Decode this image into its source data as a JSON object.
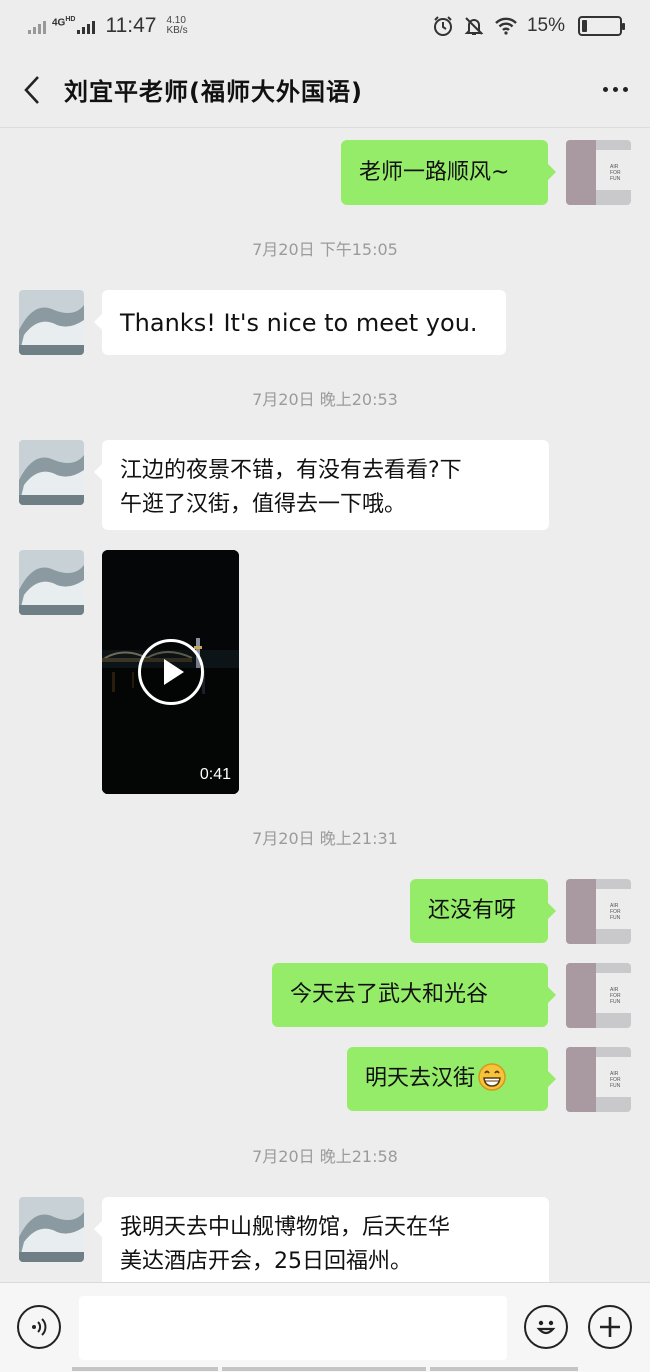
{
  "status_bar": {
    "network": "4G",
    "network_sup": "HD",
    "time": "11:47",
    "speed_value": "4.10",
    "speed_unit": "KB/s",
    "battery": "15%"
  },
  "header": {
    "title": "刘宜平老师(福师大外国语)"
  },
  "messages": {
    "m1": "老师一路顺风~",
    "ts1": "7月20日 下午15:05",
    "m2": "Thanks! It's nice to meet you.",
    "ts2": "7月20日 晚上20:53",
    "m3_line1": "江边的夜景不错，有没有去看看?下",
    "m3_line2": "午逛了汉街，值得去一下哦。",
    "video_duration": "0:41",
    "ts3": "7月20日 晚上21:31",
    "m4": "还没有呀",
    "m5": "今天去了武大和光谷",
    "m6": "明天去汉街",
    "ts4": "7月20日 晚上21:58",
    "m7_line1": "我明天去中山舰博物馆，后天在华",
    "m7_line2": "美达酒店开会，25日回福州。"
  },
  "icons": {
    "back": "chevron-left-icon",
    "more": "more-dots-icon",
    "voice": "voice-icon",
    "emoji": "emoji-icon",
    "plus": "plus-icon",
    "grin": "grinning-emoji-icon"
  },
  "colors": {
    "sent_bubble": "#95ec69",
    "received_bubble": "#ffffff",
    "background": "#ededed"
  }
}
